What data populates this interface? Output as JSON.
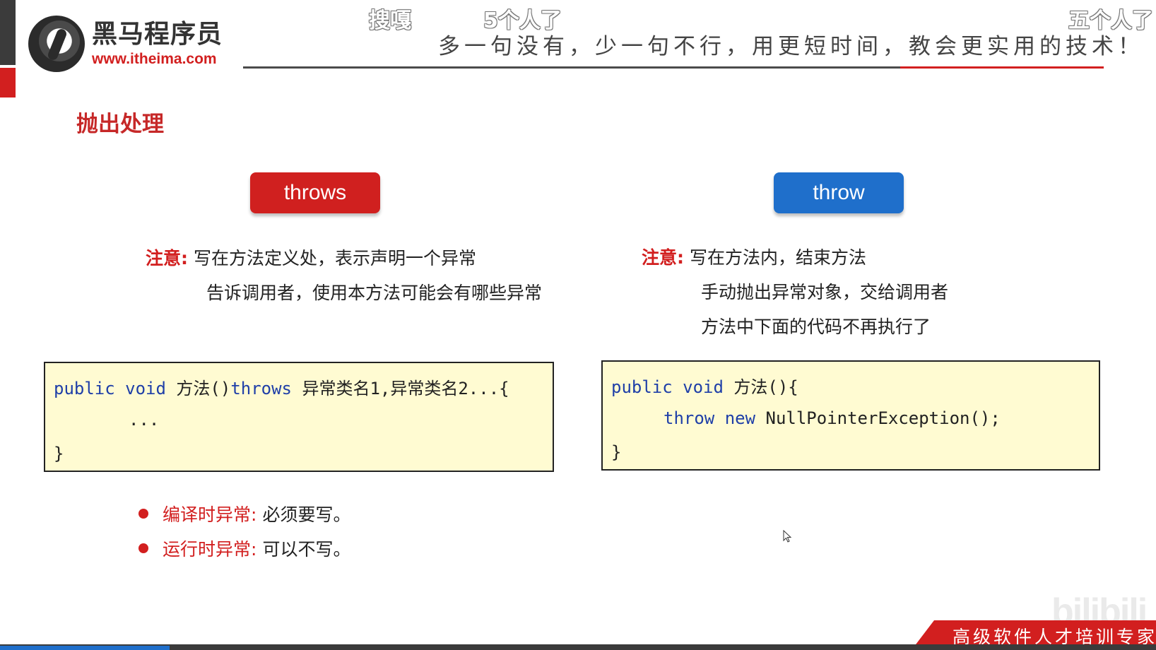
{
  "header": {
    "logo_name": "黑马程序员",
    "logo_url": "www.itheima.com",
    "slogan": "多一句没有，少一句不行，用更短时间，教会更实用的技术！"
  },
  "danmaku": [
    "搜嘎",
    "5个人了",
    "五个人了"
  ],
  "section_title": "抛出处理",
  "throws": {
    "label": "throws",
    "note_label": "注意:",
    "note_lines": [
      "写在方法定义处，表示声明一个异常",
      "告诉调用者，使用本方法可能会有哪些异常"
    ],
    "code": {
      "l1_kw": "public void",
      "l1_a": " 方法()",
      "l1_kw2": "throws",
      "l1_b": " 异常类名1,异常类名2...{",
      "l2": "...",
      "l3": "}"
    },
    "bullets": [
      {
        "label": "编译时异常:",
        "text": "必须要写。"
      },
      {
        "label": "运行时异常:",
        "text": "可以不写。"
      }
    ]
  },
  "throw": {
    "label": "throw",
    "note_label": "注意:",
    "note_lines": [
      "写在方法内，结束方法",
      "手动抛出异常对象，交给调用者",
      "方法中下面的代码不再执行了"
    ],
    "code": {
      "l1_kw": "public void",
      "l1_a": " 方法(){",
      "l2_kw": "throw new",
      "l2_a": " NullPointerException();",
      "l3": "}"
    }
  },
  "footer": {
    "tagline": "高级软件人才培训专家",
    "watermark": "bilibili"
  }
}
